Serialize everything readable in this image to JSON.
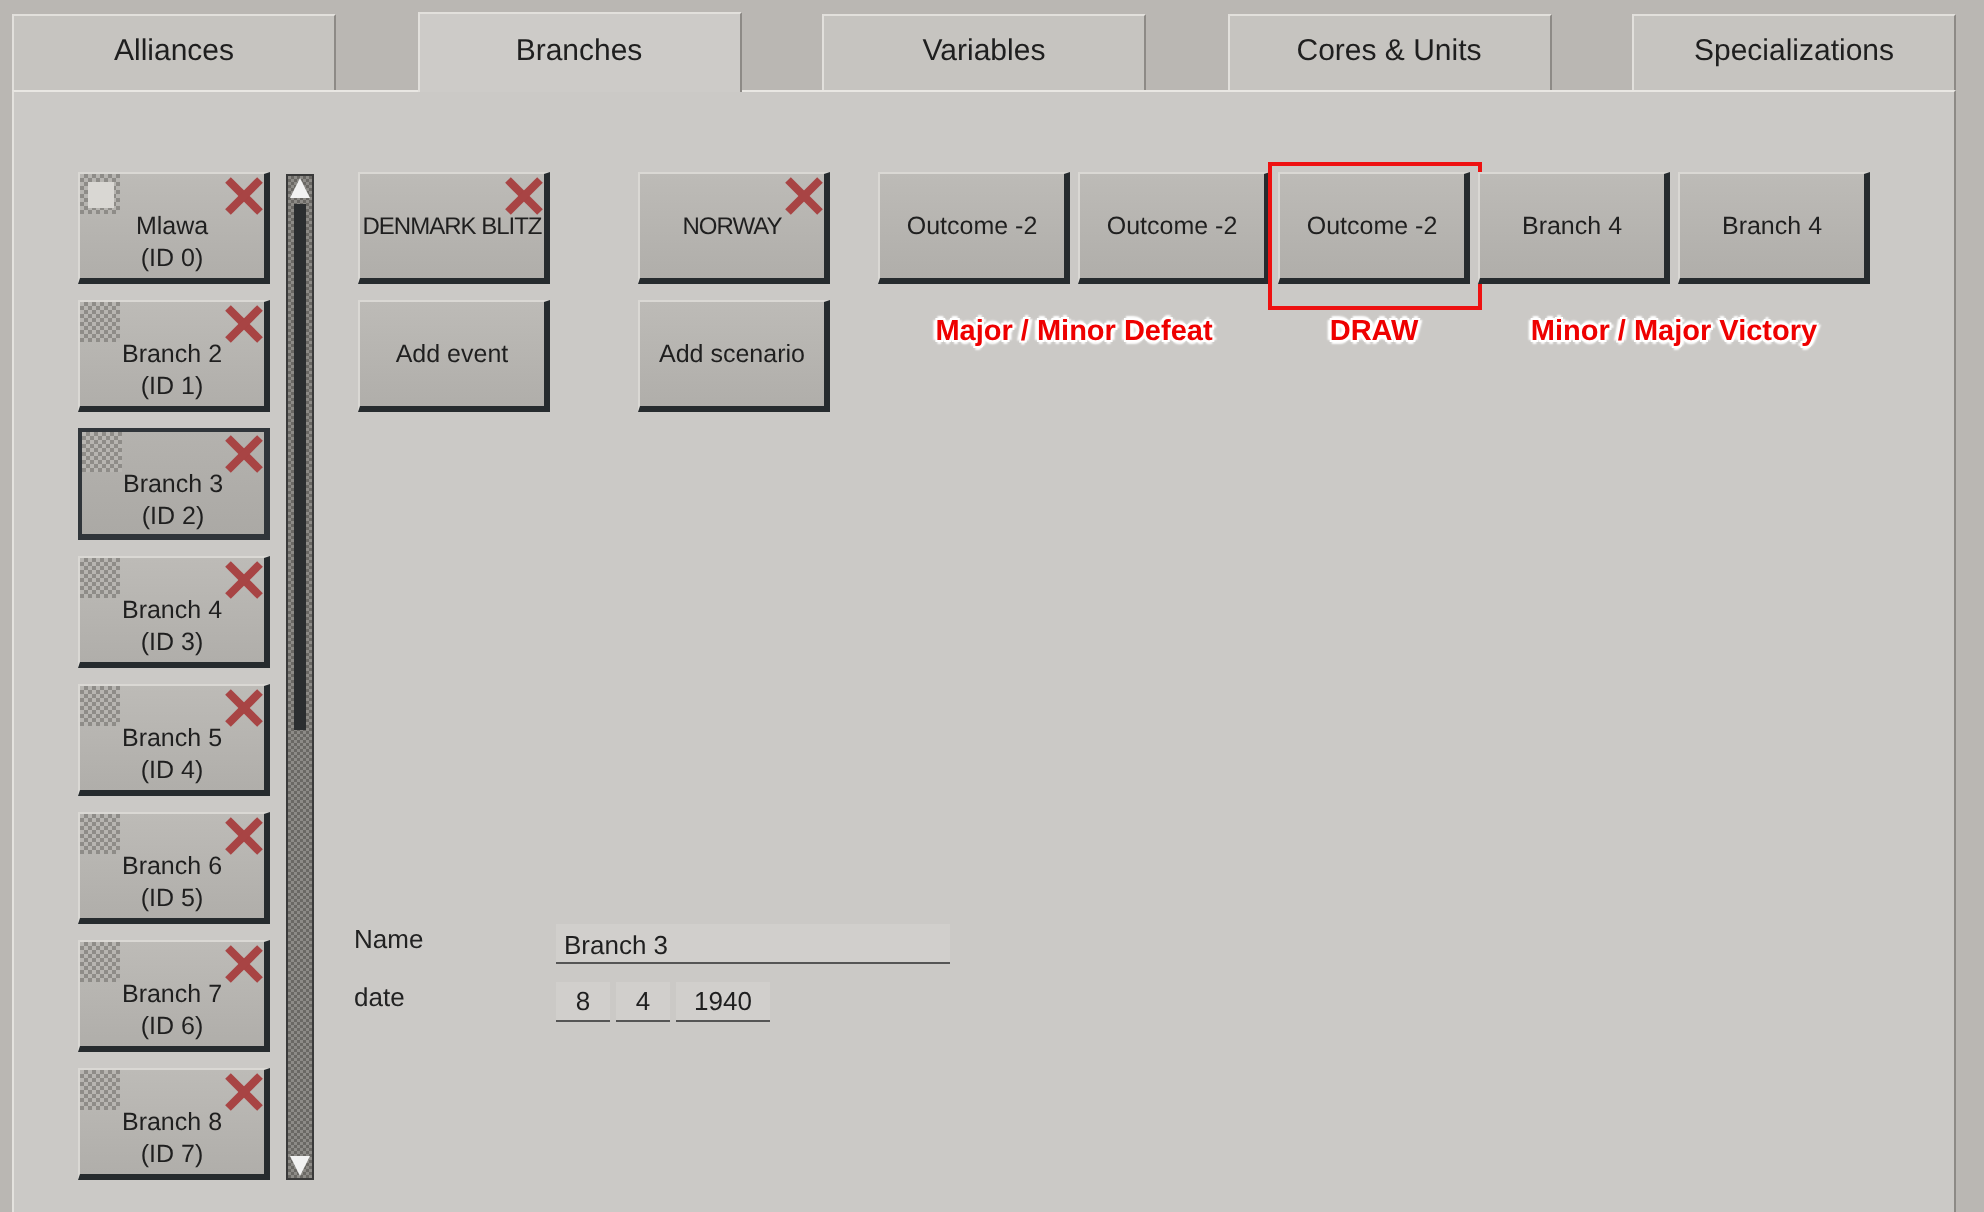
{
  "tabs": [
    {
      "label": "Alliances",
      "selected": false
    },
    {
      "label": "Branches",
      "selected": true
    },
    {
      "label": "Variables",
      "selected": false
    },
    {
      "label": "Cores & Units",
      "selected": false
    },
    {
      "label": "Specializations",
      "selected": false
    }
  ],
  "branches": [
    {
      "name": "Mlawa",
      "id_label": "(ID 0)",
      "checked": true,
      "selected": false
    },
    {
      "name": "Branch 2",
      "id_label": "(ID 1)",
      "checked": false,
      "selected": false
    },
    {
      "name": "Branch 3",
      "id_label": "(ID 2)",
      "checked": false,
      "selected": true
    },
    {
      "name": "Branch 4",
      "id_label": "(ID 3)",
      "checked": false,
      "selected": false
    },
    {
      "name": "Branch 5",
      "id_label": "(ID 4)",
      "checked": false,
      "selected": false
    },
    {
      "name": "Branch 6",
      "id_label": "(ID 5)",
      "checked": false,
      "selected": false
    },
    {
      "name": "Branch 7",
      "id_label": "(ID 6)",
      "checked": false,
      "selected": false
    },
    {
      "name": "Branch 8",
      "id_label": "(ID 7)",
      "checked": false,
      "selected": false
    }
  ],
  "events": {
    "items": [
      "DENMARK BLITZ"
    ],
    "add_button": "Add event"
  },
  "scenarios": {
    "items": [
      "NORWAY"
    ],
    "add_button": "Add scenario"
  },
  "outcome_groups": [
    {
      "caption": "Major / Minor Defeat",
      "highlighted": false,
      "outcomes": [
        "Outcome -2",
        "Outcome -2"
      ]
    },
    {
      "caption": "DRAW",
      "highlighted": true,
      "outcomes": [
        "Outcome -2"
      ]
    },
    {
      "caption": "Minor / Major Victory",
      "highlighted": false,
      "outcomes": [
        "Branch 4",
        "Branch 4"
      ]
    }
  ],
  "details": {
    "name": {
      "label": "Name",
      "value": "Branch 3"
    },
    "date": {
      "label": "date",
      "values": [
        "8",
        "4",
        "1940"
      ]
    }
  }
}
